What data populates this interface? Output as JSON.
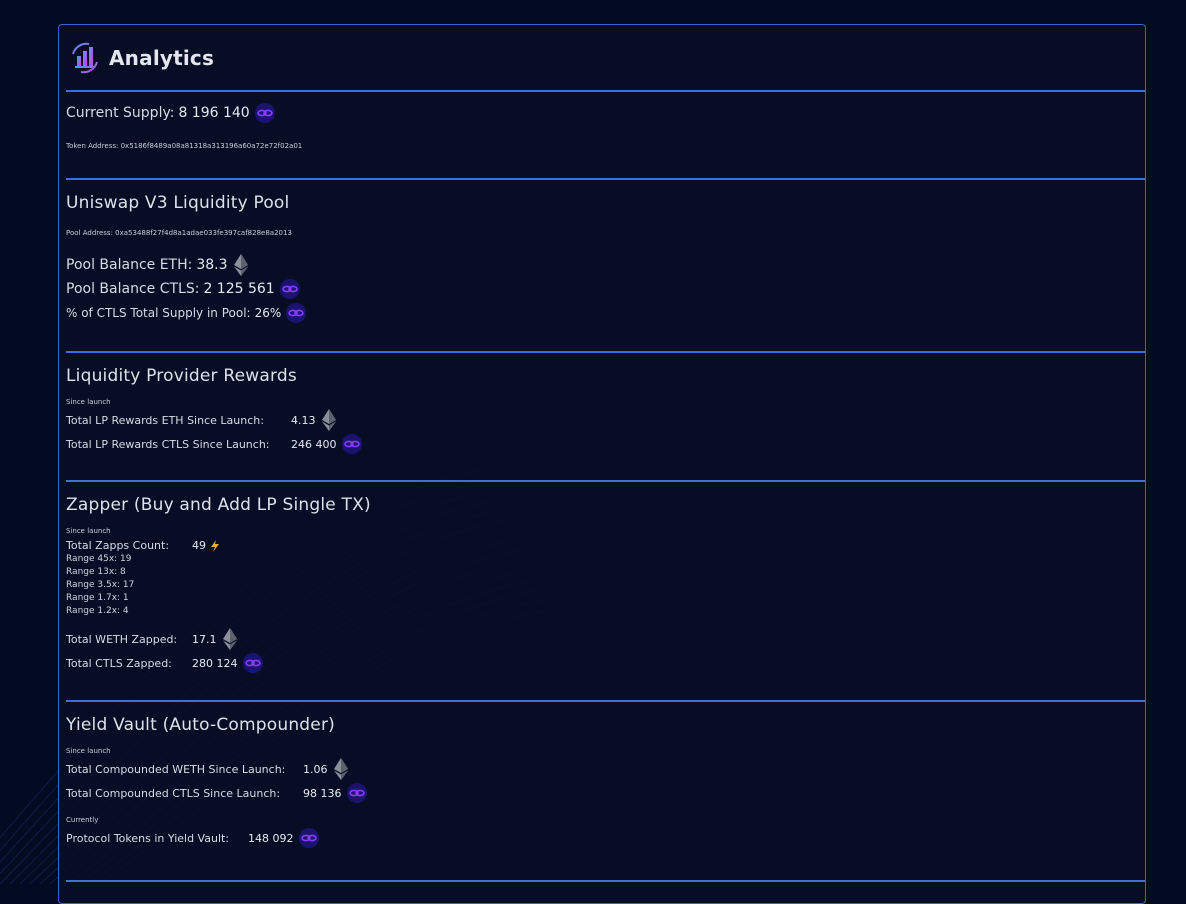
{
  "header": {
    "title": "Analytics",
    "logo_icon": "analytics-chart-icon"
  },
  "supply": {
    "label": "Current Supply:",
    "value": "8 196 140",
    "token_address": "Token Address: 0x5186f8489a08a81318a313196a60a72e72f02a01"
  },
  "uniswap": {
    "title": "Uniswap V3 Liquidity Pool",
    "pool_address": "Pool Address: 0xa53488f27f4d8a1adae033fe397caf828e8a2013",
    "eth_label": "Pool Balance ETH:",
    "eth_value": "38.3",
    "ctls_label": "Pool Balance CTLS:",
    "ctls_value": "2 125 561",
    "pct_label": "% of CTLS Total Supply in Pool:",
    "pct_value": "26%"
  },
  "lp_rewards": {
    "title": "Liquidity Provider Rewards",
    "since": "Since launch",
    "eth_label": "Total LP Rewards ETH Since Launch:",
    "eth_value": "4.13",
    "ctls_label": "Total LP Rewards CTLS Since Launch:",
    "ctls_value": "246 400"
  },
  "zapper": {
    "title": "Zapper (Buy and Add LP Single TX)",
    "since": "Since launch",
    "count_label": "Total Zapps Count:",
    "count_value": "49",
    "ranges": [
      "Range 45x: 19",
      "Range 13x: 8",
      "Range 3.5x: 17",
      "Range 1.7x: 1",
      "Range 1.2x: 4"
    ],
    "weth_label": "Total WETH Zapped:",
    "weth_value": "17.1",
    "ctls_label": "Total CTLS Zapped:",
    "ctls_value": "280 124"
  },
  "vault": {
    "title": "Yield Vault (Auto-Compounder)",
    "since": "Since launch",
    "weth_label": "Total Compounded WETH Since Launch:",
    "weth_value": "1.06",
    "ctls_label": "Total Compounded CTLS Since Launch:",
    "ctls_value": "98 136",
    "currently": "Currently",
    "tokens_label": "Protocol Tokens in Yield Vault:",
    "tokens_value": "148 092"
  },
  "colors": {
    "background": "#030b22",
    "panel_border": "#3a64c8",
    "divider": "#3d6fe0",
    "ctls_icon": "#7b2ff7",
    "bolt": "#f0a930"
  }
}
